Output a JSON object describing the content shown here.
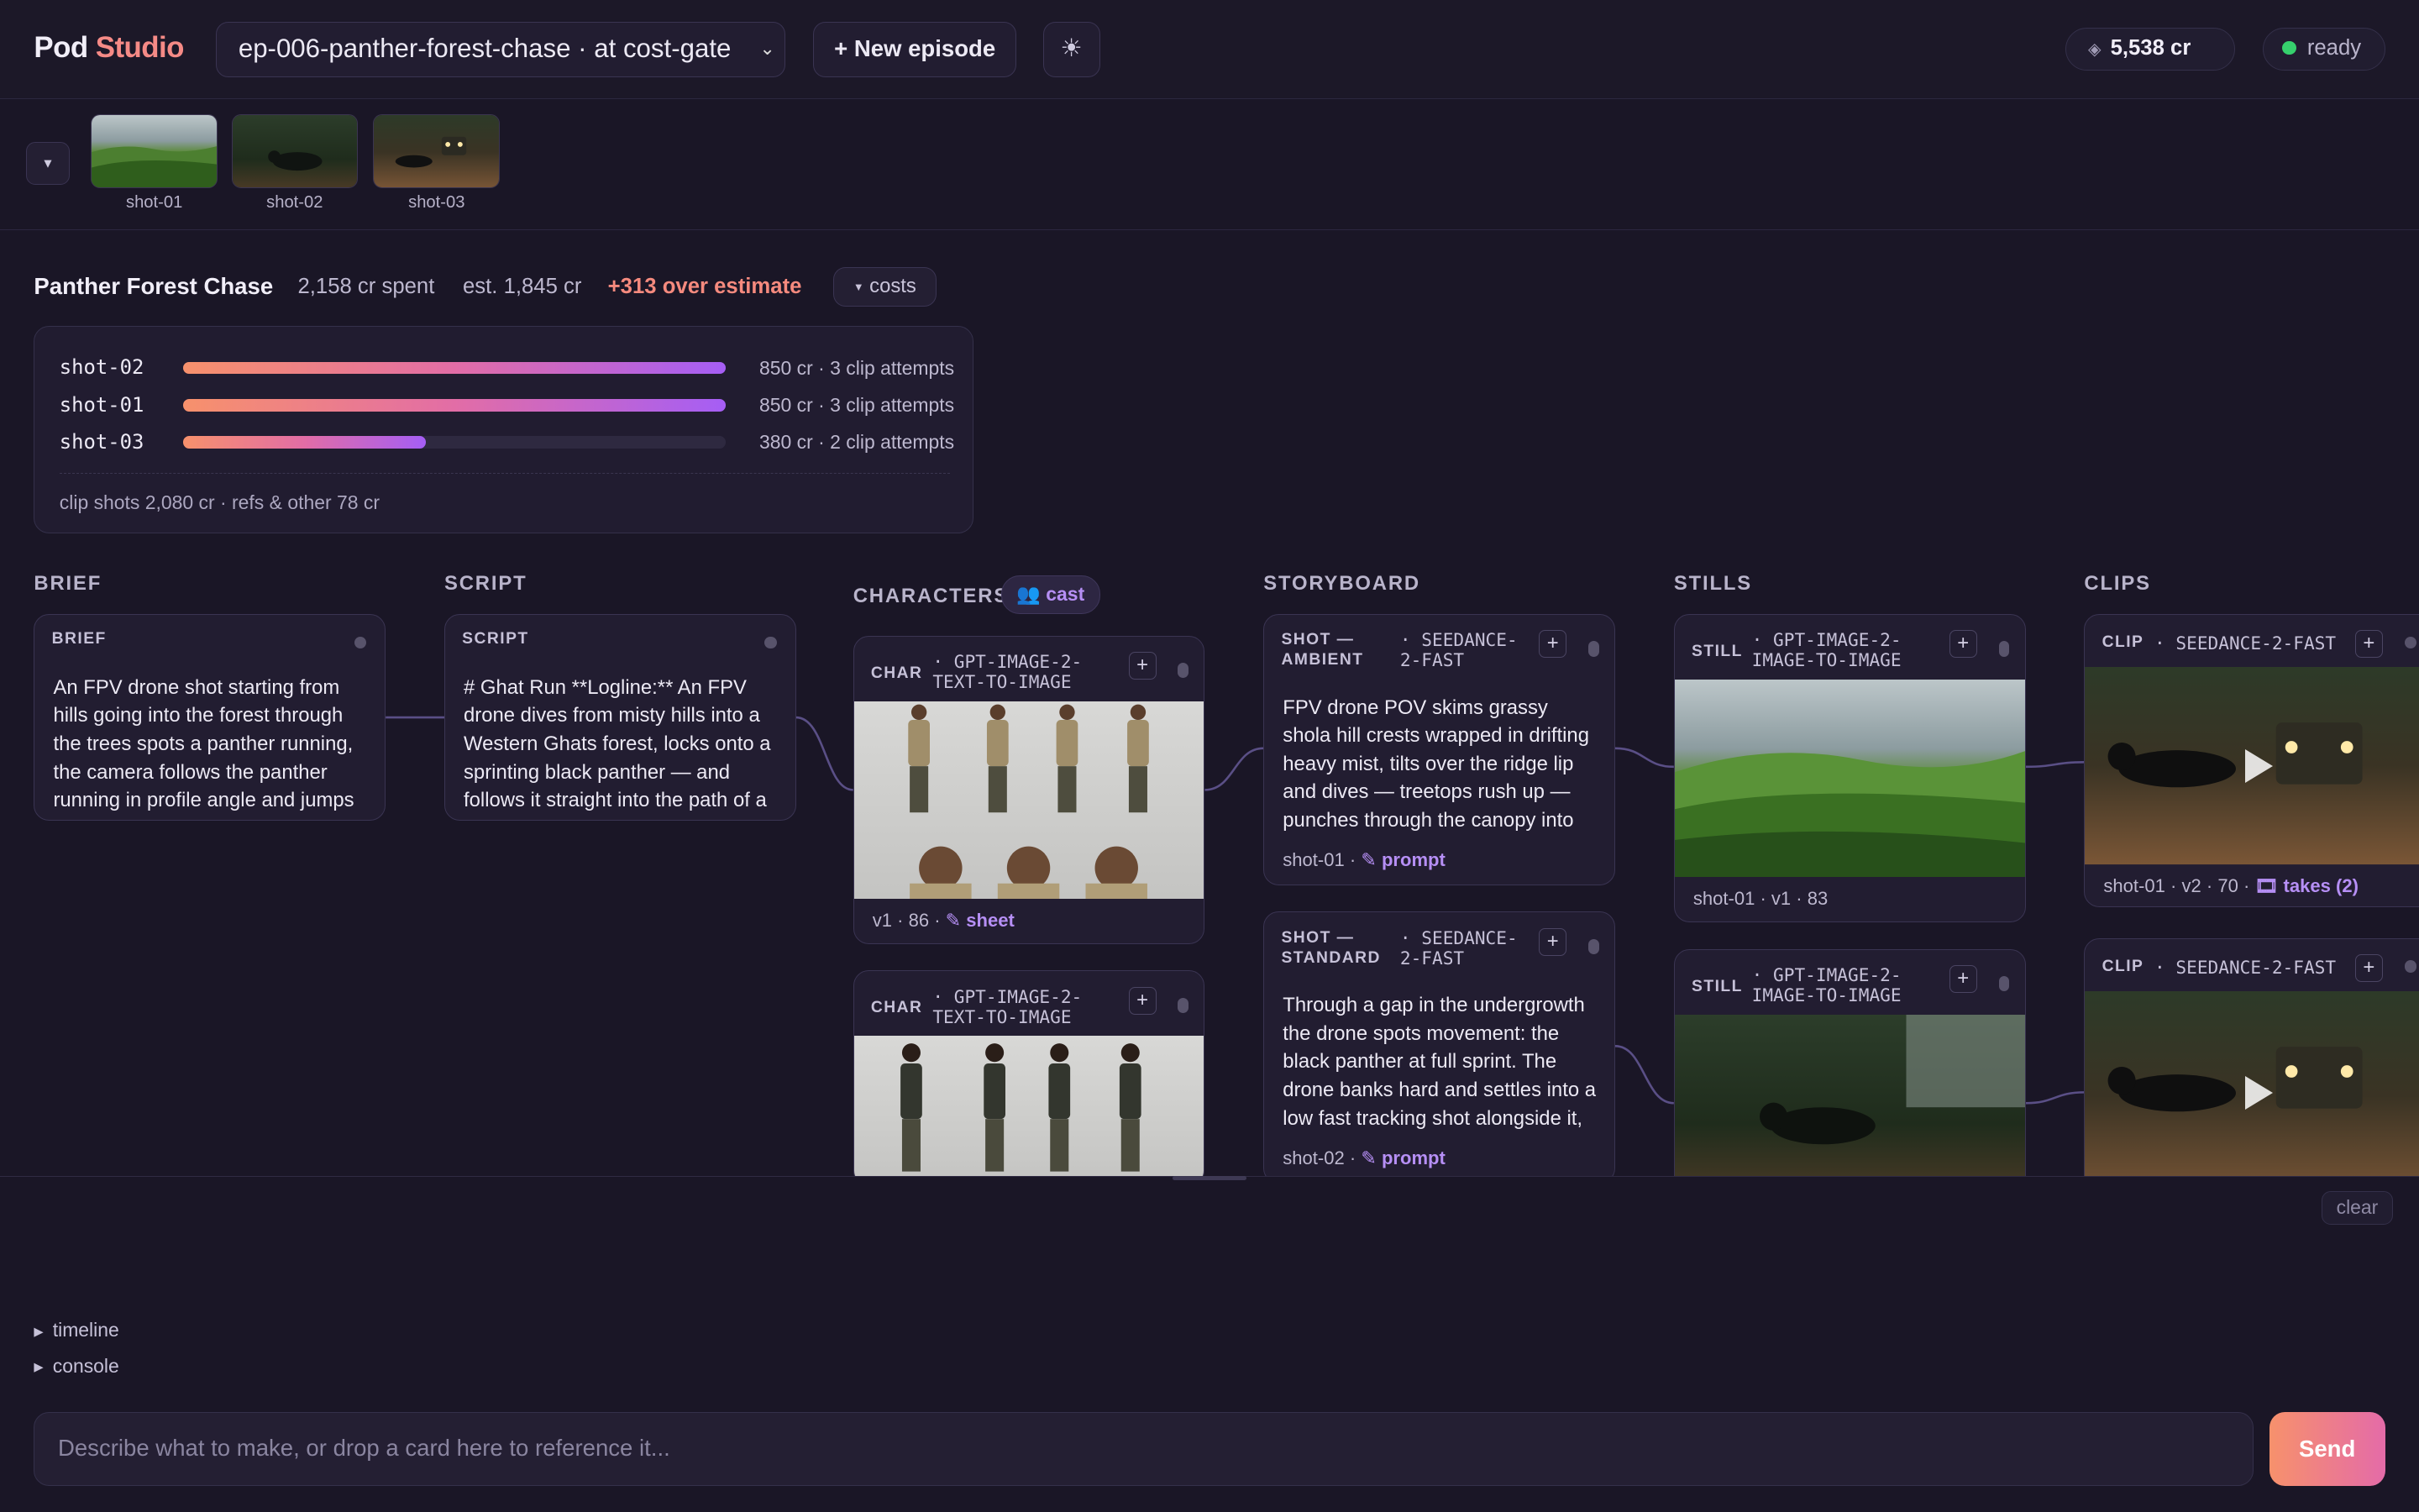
{
  "header": {
    "brand_part1": "Pod",
    "brand_part2": "Studio",
    "episode_select": "ep-006-panther-forest-chase · at cost-gate",
    "new_episode_label": "+ New episode",
    "theme_icon": "sun-icon",
    "credits": "5,538 cr",
    "status": "ready"
  },
  "strip": {
    "toggle_icon": "chevron-down-icon",
    "thumbs": [
      {
        "label": "shot-01"
      },
      {
        "label": "shot-02"
      },
      {
        "label": "shot-03"
      }
    ]
  },
  "project": {
    "title": "Panther Forest Chase",
    "spent": "2,158 cr spent",
    "estimate": "est. 1,845 cr",
    "over": "+313 over estimate",
    "costs_label": "costs"
  },
  "budget": {
    "rows": [
      {
        "shot": "shot-02",
        "value": "850 cr · 3 clip attempts",
        "fraction": 1.0
      },
      {
        "shot": "shot-01",
        "value": "850 cr · 3 clip attempts",
        "fraction": 1.0
      },
      {
        "shot": "shot-03",
        "value": "380 cr · 2 clip attempts",
        "fraction": 0.447
      }
    ],
    "footer": "clip shots 2,080 cr · refs & other 78 cr"
  },
  "columns": {
    "brief": "BRIEF",
    "script": "SCRIPT",
    "characters": "CHARACTERS",
    "cast_label": "cast",
    "storyboard": "STORYBOARD",
    "stills": "STILLS",
    "clips": "CLIPS"
  },
  "cards": {
    "brief": {
      "tag": "BRIEF",
      "text": "An FPV drone shot starting from hills going into the forest through the trees spots a panther running, the camera follows the panther running in profile angle and jumps across a hill road and..."
    },
    "script": {
      "tag": "SCRIPT",
      "text": "# Ghat Run **Logline:** An FPV drone dives from misty hills into a Western Ghats forest, locks onto a sprinting black panther — and follows it straight into the path of a jeep on the ghat road..."
    },
    "char1": {
      "tag": "CHAR",
      "model": "· GPT-IMAGE-2-TEXT-TO-IMAGE",
      "foot": "v1 · 86 ·",
      "link": "sheet"
    },
    "char2": {
      "tag": "CHAR",
      "model": "· GPT-IMAGE-2-TEXT-TO-IMAGE"
    },
    "shot1": {
      "tag": "SHOT — AMBIENT",
      "model": "· SEEDANCE-2-FAST",
      "text": "FPV drone POV skims grassy shola hill crests wrapped in drifting heavy mist, tilts over the ridge lip and dives — treetops rush up — punches through the canopy into the forest...",
      "foot": "shot-01 ·",
      "link": "prompt"
    },
    "shot2": {
      "tag": "SHOT — STANDARD",
      "model": "· SEEDANCE-2-FAST",
      "text": "Through a gap in the undergrowth the drone spots movement: the black panther at full sprint. The drone banks hard and settles into a low fast tracking shot alongside it, profile angle...",
      "foot": "shot-02 ·",
      "link": "prompt"
    },
    "still1": {
      "tag": "STILL",
      "model": "· GPT-IMAGE-2-IMAGE-TO-IMAGE",
      "foot": "shot-01 · v1 · 83"
    },
    "still2": {
      "tag": "STILL",
      "model": "· GPT-IMAGE-2-IMAGE-TO-IMAGE"
    },
    "clip1": {
      "tag": "CLIP",
      "model": "· SEEDANCE-2-FAST",
      "foot": "shot-01 · v2 · 70 ·",
      "link": "takes (2)"
    },
    "clip2": {
      "tag": "CLIP",
      "model": "· SEEDANCE-2-FAST"
    }
  },
  "bottom": {
    "clear_label": "clear",
    "timeline_label": "timeline",
    "console_label": "console",
    "prompt_placeholder": "Describe what to make, or drop a card here to reference it...",
    "send_label": "Send"
  },
  "colors": {
    "accent_coral": "#f58a86",
    "accent_purple": "#b68ff5",
    "ready_green": "#36d06d",
    "background": "#1a1626"
  }
}
